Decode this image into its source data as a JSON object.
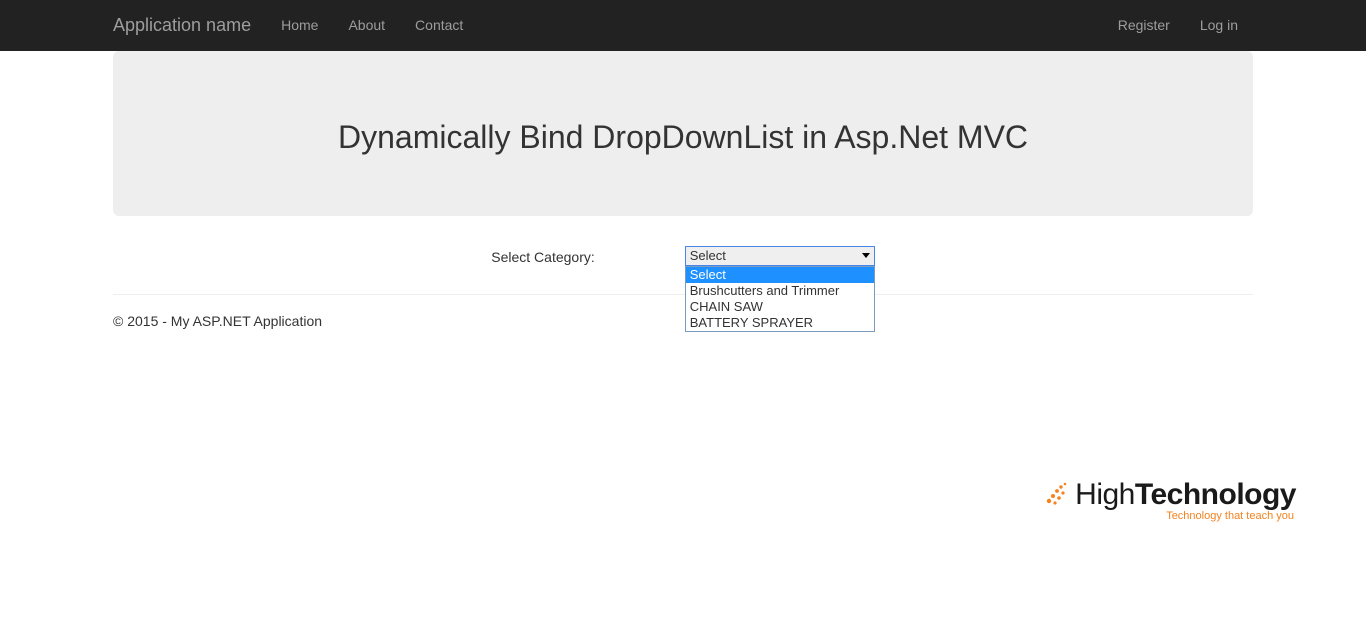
{
  "navbar": {
    "brand": "Application name",
    "left": [
      "Home",
      "About",
      "Contact"
    ],
    "right": [
      "Register",
      "Log in"
    ]
  },
  "hero": {
    "title": "Dynamically Bind DropDownList in Asp.Net MVC"
  },
  "form": {
    "label": "Select Category:",
    "selected": "Select",
    "options": [
      "Select",
      "Brushcutters and Trimmer",
      "CHAIN SAW",
      "BATTERY SPRAYER"
    ]
  },
  "footer": {
    "text": "© 2015 - My ASP.NET Application"
  },
  "watermark": {
    "brand_light": "High",
    "brand_bold": "Technology",
    "tagline": "Technology that teach you"
  }
}
